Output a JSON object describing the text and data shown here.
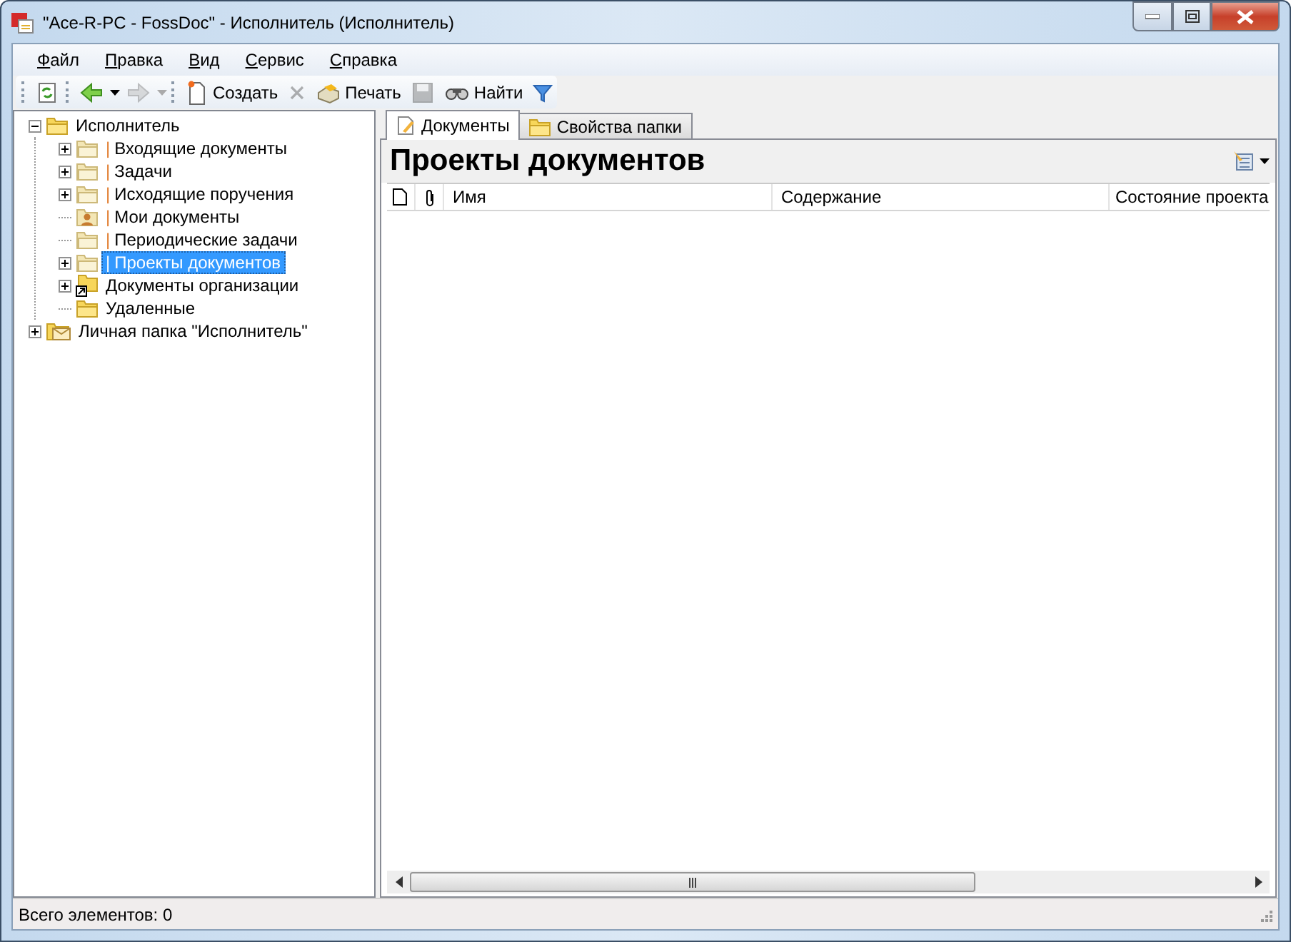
{
  "window": {
    "title": "\"Ace-R-PC - FossDoc\" - Исполнитель (Исполнитель)"
  },
  "menu": [
    "Файл",
    "Правка",
    "Вид",
    "Сервис",
    "Справка"
  ],
  "toolbar": [
    {
      "kind": "refresh",
      "disabled": false
    },
    {
      "kind": "back",
      "disabled": false
    },
    {
      "kind": "forward",
      "disabled": true
    },
    {
      "kind": "create",
      "label": "Создать",
      "disabled": false
    },
    {
      "kind": "delete",
      "disabled": true
    },
    {
      "kind": "print",
      "label": "Печать",
      "disabled": false
    },
    {
      "kind": "save",
      "disabled": true
    },
    {
      "kind": "find",
      "label": "Найти",
      "disabled": false
    },
    {
      "kind": "filter",
      "disabled": false
    }
  ],
  "tree": [
    {
      "label": "Исполнитель",
      "kind": "folder",
      "expandable": true,
      "expanded": true,
      "selected": false,
      "children": [
        {
          "marker": "|",
          "label": "Входящие документы",
          "kind": "pale",
          "expandable": true,
          "expanded": false,
          "selected": false
        },
        {
          "marker": "|",
          "label": "Задачи",
          "kind": "pale",
          "expandable": true,
          "expanded": false,
          "selected": false
        },
        {
          "marker": "|",
          "label": "Исходящие поручения",
          "kind": "pale",
          "expandable": true,
          "expanded": false,
          "selected": false
        },
        {
          "marker": "|",
          "label": "Мои документы",
          "kind": "personal",
          "expandable": false,
          "selected": false
        },
        {
          "marker": "|",
          "label": "Периодические задачи",
          "kind": "pale",
          "expandable": false,
          "selected": false
        },
        {
          "marker": "|",
          "label": "Проекты документов",
          "kind": "pale",
          "expandable": true,
          "expanded": false,
          "selected": true
        },
        {
          "label": "Документы организации",
          "kind": "shortcut",
          "expandable": true,
          "expanded": false,
          "selected": false
        },
        {
          "label": "Удаленные",
          "kind": "folder",
          "expandable": false,
          "selected": false
        }
      ]
    },
    {
      "label": "Личная папка \"Исполнитель\"",
      "kind": "mailbox",
      "expandable": true,
      "expanded": false,
      "selected": false
    }
  ],
  "tabs": [
    {
      "label": "Документы",
      "selected": true
    },
    {
      "label": "Свойства папки",
      "selected": false
    }
  ],
  "pane": {
    "title": "Проекты документов"
  },
  "table": {
    "columns": [
      "Имя",
      "Содержание",
      "Состояние проекта"
    ]
  },
  "status_bar": "Всего элементов: 0"
}
